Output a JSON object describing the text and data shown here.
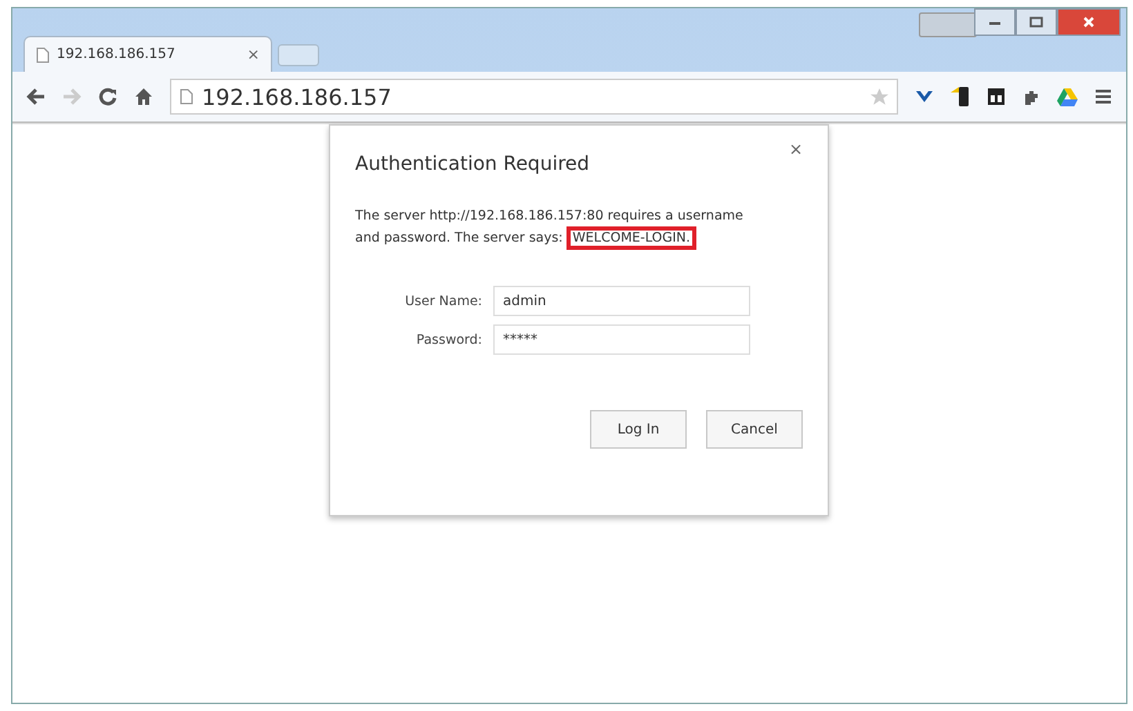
{
  "tab": {
    "title": "192.168.186.157",
    "close": "×"
  },
  "address_bar": {
    "value": "192.168.186.157"
  },
  "dialog": {
    "title": "Authentication Required",
    "close": "×",
    "message": "The server http://192.168.186.157:80 requires a username and password. The server says:",
    "highlighted": "WELCOME-LOGIN.",
    "fields": [
      {
        "label": "User Name:",
        "value": "admin"
      },
      {
        "label": "Password:",
        "value": "*****"
      }
    ],
    "buttons": [
      "Log In",
      "Cancel"
    ]
  }
}
